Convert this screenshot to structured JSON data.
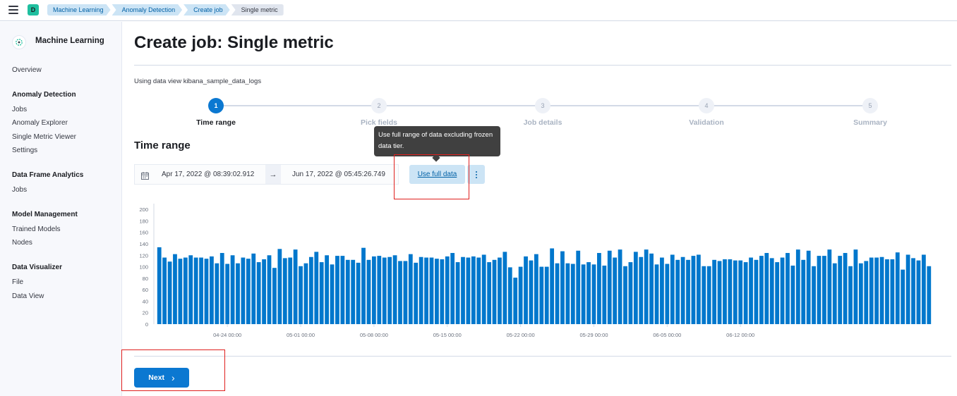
{
  "header": {
    "space_initial": "D",
    "breadcrumbs": [
      "Machine Learning",
      "Anomaly Detection",
      "Create job",
      "Single metric"
    ]
  },
  "sidebar": {
    "title": "Machine Learning",
    "overview": "Overview",
    "anomaly_detection": {
      "heading": "Anomaly Detection",
      "items": [
        "Jobs",
        "Anomaly Explorer",
        "Single Metric Viewer",
        "Settings"
      ]
    },
    "data_frame_analytics": {
      "heading": "Data Frame Analytics",
      "items": [
        "Jobs"
      ]
    },
    "model_management": {
      "heading": "Model Management",
      "items": [
        "Trained Models",
        "Nodes"
      ]
    },
    "data_visualizer": {
      "heading": "Data Visualizer",
      "items": [
        "File",
        "Data View"
      ]
    }
  },
  "main": {
    "title": "Create job: Single metric",
    "data_view_text": "Using data view kibana_sample_data_logs",
    "steps": [
      {
        "number": "1",
        "label": "Time range",
        "active": true
      },
      {
        "number": "2",
        "label": "Pick fields",
        "active": false
      },
      {
        "number": "3",
        "label": "Job details",
        "active": false
      },
      {
        "number": "4",
        "label": "Validation",
        "active": false
      },
      {
        "number": "5",
        "label": "Summary",
        "active": false
      }
    ],
    "section_title": "Time range",
    "start_date": "Apr 17, 2022 @ 08:39:02.912",
    "arrow": "→",
    "end_date": "Jun 17, 2022 @ 05:45:26.749",
    "use_full_data": "Use full data",
    "tooltip": "Use full range of data excluding frozen data tier.",
    "next_label": "Next",
    "next_chevron": "›"
  },
  "colors": {
    "accent": "#0b78d1",
    "bar": "#0077cc",
    "highlight": "#e0201e"
  },
  "chart_data": {
    "type": "bar",
    "ylim": [
      0,
      210
    ],
    "yticks": [
      0,
      20,
      40,
      60,
      80,
      100,
      120,
      140,
      160,
      180,
      200
    ],
    "xtick_labels": [
      "04-24 00:00",
      "05-01 00:00",
      "05-08 00:00",
      "05-15 00:00",
      "05-22 00:00",
      "05-29 00:00",
      "06-05 00:00",
      "06-12 00:00"
    ],
    "xtick_bar_index": [
      13,
      27,
      41,
      55,
      69,
      83,
      97,
      111
    ],
    "values": [
      134,
      116,
      109,
      122,
      114,
      116,
      120,
      116,
      116,
      114,
      118,
      106,
      124,
      105,
      120,
      106,
      116,
      114,
      123,
      108,
      113,
      120,
      98,
      131,
      115,
      116,
      130,
      101,
      106,
      117,
      126,
      108,
      120,
      104,
      119,
      119,
      112,
      112,
      107,
      133,
      112,
      118,
      119,
      116,
      117,
      120,
      110,
      110,
      122,
      107,
      117,
      116,
      116,
      114,
      113,
      118,
      124,
      108,
      117,
      116,
      118,
      116,
      121,
      108,
      112,
      116,
      126,
      99,
      81,
      100,
      118,
      111,
      122,
      100,
      100,
      132,
      106,
      127,
      106,
      105,
      128,
      104,
      108,
      104,
      124,
      102,
      128,
      116,
      130,
      101,
      108,
      126,
      117,
      130,
      123,
      104,
      116,
      105,
      121,
      112,
      117,
      112,
      119,
      121,
      101,
      101,
      112,
      110,
      113,
      113,
      111,
      111,
      108,
      116,
      112,
      119,
      124,
      115,
      108,
      116,
      124,
      102,
      130,
      112,
      128,
      101,
      119,
      119,
      130,
      106,
      119,
      124,
      101,
      130,
      106,
      110,
      116,
      116,
      117,
      113,
      113,
      125,
      95,
      121,
      115,
      111,
      121,
      101
    ]
  }
}
